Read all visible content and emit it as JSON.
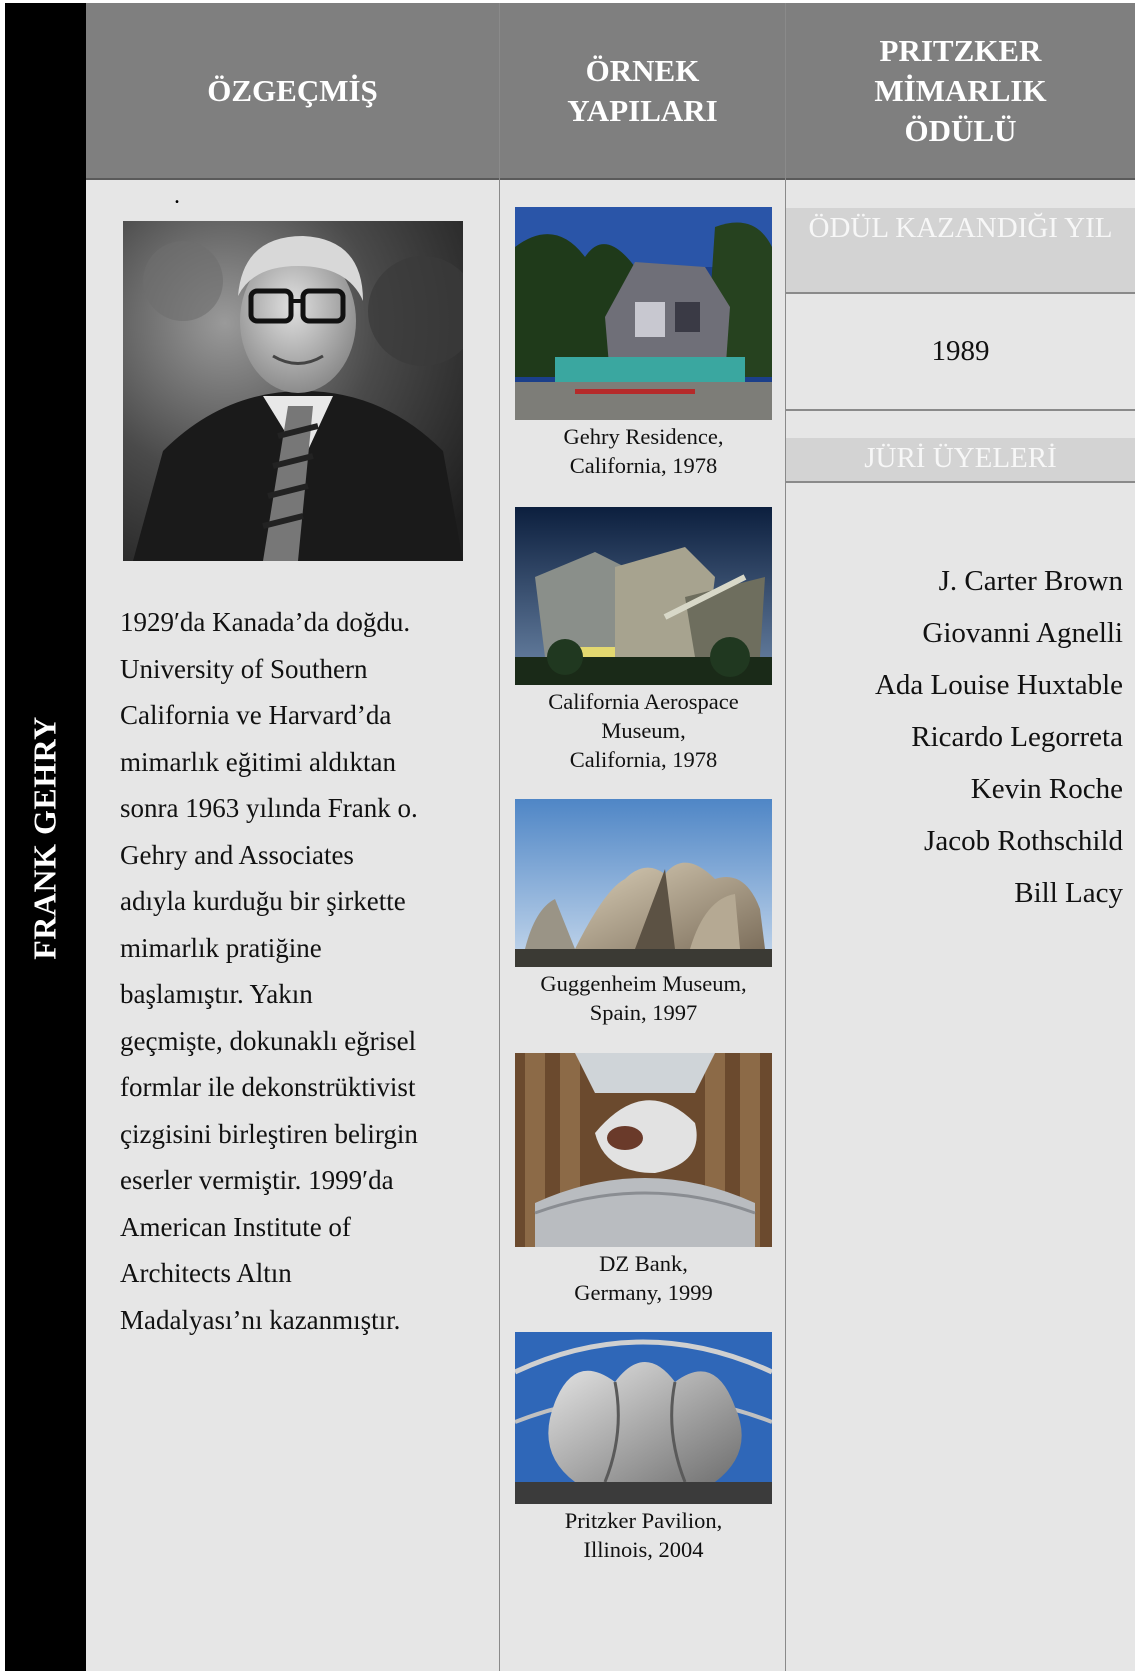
{
  "sidebar": {
    "title": "FRANK GEHRY"
  },
  "columns": {
    "bio_header": "ÖZGEÇMİŞ",
    "works_header": "ÖRNEK\nYAPILARI",
    "prize_header": "PRITZKER\nMİMARLIK\nÖDÜLÜ"
  },
  "bio": {
    "dot": ".",
    "lines": [
      "1929′da Kanada’da doğdu.",
      "University of Southern",
      "California ve Harvard’da",
      "mimarlık eğitimi aldıktan",
      "sonra 1963 yılında Frank o.",
      "Gehry and Associates",
      "adıyla kurduğu bir şirkette",
      "mimarlık pratiğine",
      "başlamıştır. Yakın",
      "geçmişte, dokunaklı eğrisel",
      "formlar ile dekonstrüktivist",
      "çizgisini birleştiren belirgin",
      "eserler vermiştir.  1999′da",
      "American Institute of",
      "Architects Altın",
      "Madalyası’nı  kazanmıştır."
    ]
  },
  "works": [
    {
      "line1": "Gehry Residence,",
      "line2": "California, 1978"
    },
    {
      "line1": "California Aerospace",
      "line2": "Museum,",
      "line3": "California, 1978"
    },
    {
      "line1": "Guggenheim Museum,",
      "line2": "Spain, 1997"
    },
    {
      "line1": "DZ Bank,",
      "line2": "Germany, 1999"
    },
    {
      "line1": "Pritzker Pavilion,",
      "line2": "Illinois, 2004"
    }
  ],
  "prize": {
    "year_label": "ÖDÜL KAZANDIĞI YIL",
    "year": "1989",
    "jury_label": "JÜRİ ÜYELERİ",
    "jury": [
      "J. Carter Brown",
      "Giovanni Agnelli",
      "Ada Louise Huxtable",
      "Ricardo Legorreta",
      "Kevin Roche",
      "Jacob Rothschild",
      "Bill Lacy"
    ]
  }
}
